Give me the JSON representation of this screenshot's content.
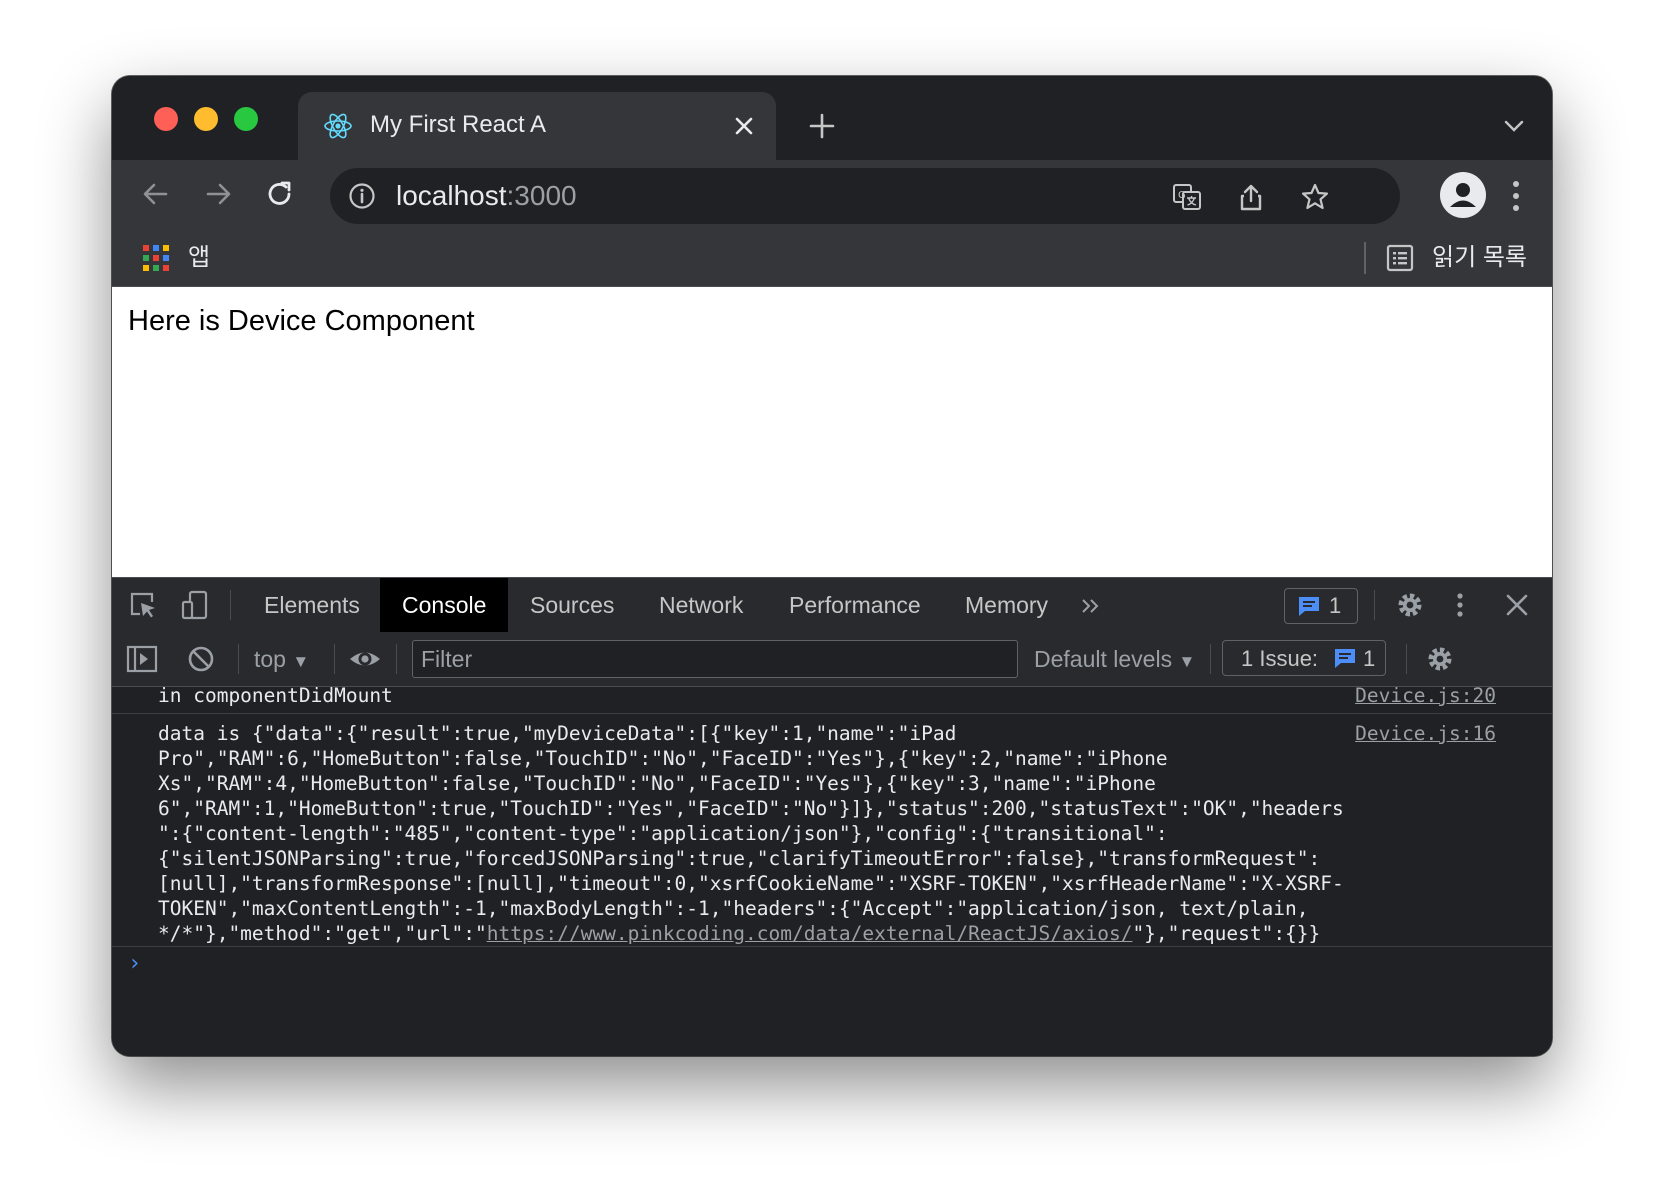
{
  "browser": {
    "tab_title": "My First React A",
    "url_host": "localhost",
    "url_port": ":3000",
    "bookmarks": {
      "apps_label": "앱",
      "reading_list_label": "읽기 목록"
    }
  },
  "page": {
    "text": "Here is Device Component"
  },
  "devtools": {
    "tabs": [
      "Elements",
      "Console",
      "Sources",
      "Network",
      "Performance",
      "Memory"
    ],
    "active_tab": "Console",
    "message_count": "1",
    "console_toolbar": {
      "context": "top",
      "filter_placeholder": "Filter",
      "levels": "Default levels",
      "issues_label": "1 Issue:",
      "issues_count": "1"
    },
    "logs": [
      {
        "message": "in componentDidMount",
        "source": "Device.js:20"
      },
      {
        "lines": [
          "data is {\"data\":{\"result\":true,\"myDeviceData\":[{\"key\":1,\"name\":\"iPad",
          "Pro\",\"RAM\":6,\"HomeButton\":false,\"TouchID\":\"No\",\"FaceID\":\"Yes\"},{\"key\":2,\"name\":\"iPhone",
          "Xs\",\"RAM\":4,\"HomeButton\":false,\"TouchID\":\"No\",\"FaceID\":\"Yes\"},{\"key\":3,\"name\":\"iPhone",
          "6\",\"RAM\":1,\"HomeButton\":true,\"TouchID\":\"Yes\",\"FaceID\":\"No\"}]},\"status\":200,\"statusText\":\"OK\",\"headers",
          "\":{\"content-length\":\"485\",\"content-type\":\"application/json\"},\"config\":{\"transitional\":",
          "{\"silentJSONParsing\":true,\"forcedJSONParsing\":true,\"clarifyTimeoutError\":false},\"transformRequest\":",
          "[null],\"transformResponse\":[null],\"timeout\":0,\"xsrfCookieName\":\"XSRF-TOKEN\",\"xsrfHeaderName\":\"X-XSRF-",
          "TOKEN\",\"maxContentLength\":-1,\"maxBodyLength\":-1,\"headers\":{\"Accept\":\"application/json, text/plain,"
        ],
        "last_line_prefix": "*/*\"},\"method\":\"get\",\"url\":\"",
        "last_line_link": "https://www.pinkcoding.com/data/external/ReactJS/axios/",
        "last_line_suffix": "\"},\"request\":{}}",
        "source": "Device.js:16"
      }
    ],
    "prompt_symbol": "›"
  },
  "colors": {
    "accent_blue": "#4c8df6",
    "chrome_dark": "#202124",
    "chrome_mid": "#35363a"
  }
}
